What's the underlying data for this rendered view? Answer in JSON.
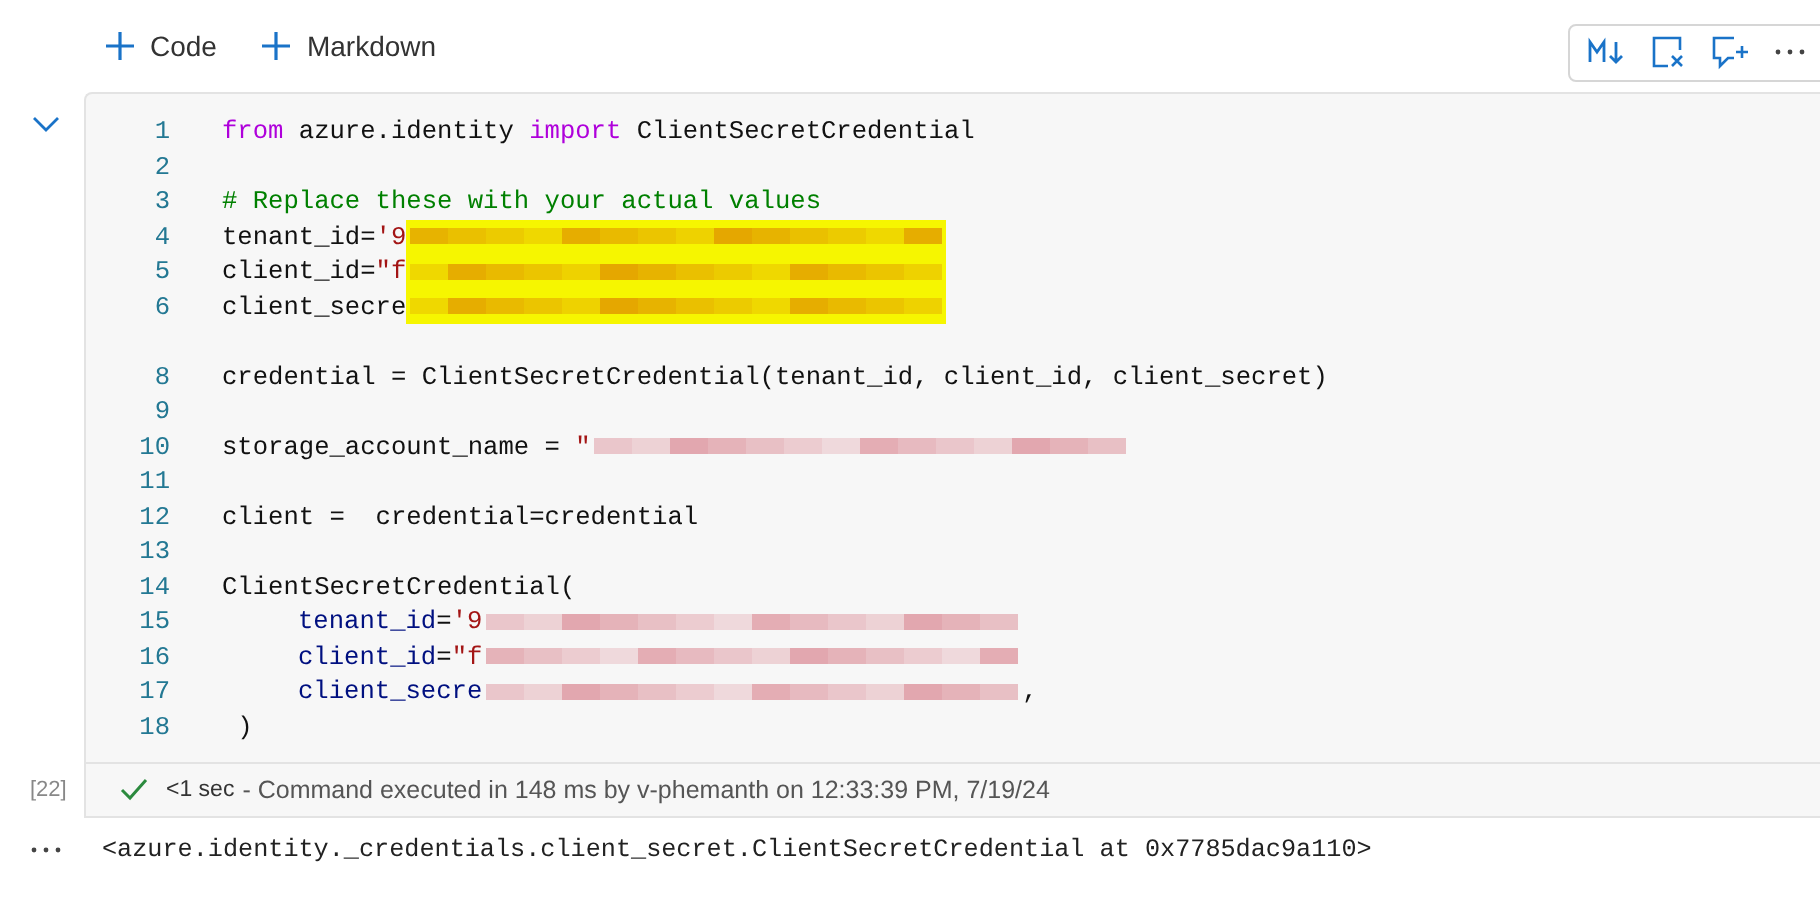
{
  "toolbar": {
    "add_buttons": [
      "Code",
      "Markdown"
    ]
  },
  "cell": {
    "expanded": true,
    "lines": [
      {
        "number": "1",
        "tokens": [
          {
            "kind": "keyword",
            "text": "from"
          },
          {
            "kind": "plain",
            "text": " azure.identity "
          },
          {
            "kind": "keyword",
            "text": "import"
          },
          {
            "kind": "plain",
            "text": " ClientSecretCredential"
          }
        ]
      },
      {
        "number": "2"
      },
      {
        "number": "3",
        "tokens": [
          {
            "kind": "comment",
            "text": "# Replace these with your actual values"
          }
        ]
      },
      {
        "number": "4",
        "tokens": [
          {
            "kind": "plain",
            "text": "tenant_id="
          },
          {
            "kind": "string",
            "text": "'9"
          },
          {
            "kind": "redaction",
            "highlighted": true
          }
        ]
      },
      {
        "number": "5",
        "tokens": [
          {
            "kind": "plain",
            "text": "client_id="
          },
          {
            "kind": "string",
            "text": "\"f"
          },
          {
            "kind": "redaction",
            "highlighted": true
          }
        ]
      },
      {
        "number": "6",
        "tokens": [
          {
            "kind": "plain",
            "text": "client_secre"
          },
          {
            "kind": "redaction",
            "highlighted": true
          }
        ]
      },
      {
        "number": "8",
        "gap_before": true,
        "tokens": [
          {
            "kind": "plain",
            "text": "credential = ClientSecretCredential(tenant_id, client_id, client_secret)"
          }
        ]
      },
      {
        "number": "9"
      },
      {
        "number": "10",
        "tokens": [
          {
            "kind": "plain",
            "text": "storage_account_name = "
          },
          {
            "kind": "string",
            "text": "\""
          },
          {
            "kind": "redaction",
            "highlighted": false
          }
        ]
      },
      {
        "number": "11"
      },
      {
        "number": "12",
        "tokens": [
          {
            "kind": "plain",
            "text": "client =  credential=credential"
          }
        ]
      },
      {
        "number": "13"
      },
      {
        "number": "14",
        "tokens": [
          {
            "kind": "plain",
            "text": "ClientSecretCredential("
          }
        ]
      },
      {
        "number": "15",
        "indent": true,
        "tokens": [
          {
            "kind": "param",
            "text": "tenant_id"
          },
          {
            "kind": "plain",
            "text": "="
          },
          {
            "kind": "string",
            "text": "'9"
          },
          {
            "kind": "redaction",
            "highlighted": false
          }
        ]
      },
      {
        "number": "16",
        "indent": true,
        "tokens": [
          {
            "kind": "param",
            "text": "client_id"
          },
          {
            "kind": "plain",
            "text": "="
          },
          {
            "kind": "string",
            "text": "\"f"
          },
          {
            "kind": "redaction",
            "highlighted": false
          }
        ]
      },
      {
        "number": "17",
        "indent": true,
        "tokens": [
          {
            "kind": "param",
            "text": "client_secre"
          },
          {
            "kind": "redaction",
            "highlighted": false
          },
          {
            "kind": "plain",
            "text": ","
          }
        ]
      },
      {
        "number": "18",
        "tokens": [
          {
            "kind": "plain",
            "text": " )"
          }
        ]
      }
    ],
    "execution_count": "[22]",
    "succeeded": true,
    "duration": "<1 sec",
    "status_text": "- Command executed in 148 ms by v-phemanth on 12:33:39 PM, 7/19/24"
  },
  "output": {
    "text": "<azure.identity._credentials.client_secret.ClientSecretCredential at 0x7785dac9a110>"
  }
}
